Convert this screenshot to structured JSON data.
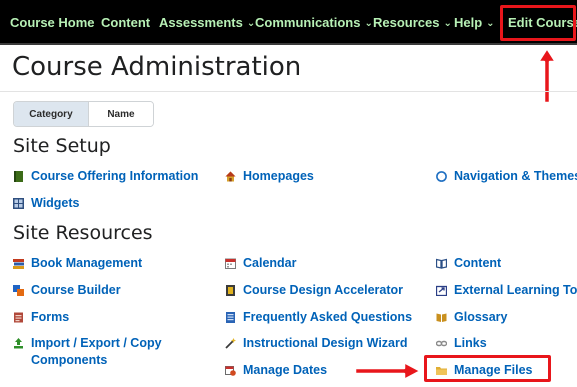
{
  "navbar": {
    "items": [
      {
        "label": "Course Home",
        "dropdown": false
      },
      {
        "label": "Content",
        "dropdown": false
      },
      {
        "label": "Assessments",
        "dropdown": true
      },
      {
        "label": "Communications",
        "dropdown": true
      },
      {
        "label": "Resources",
        "dropdown": true
      },
      {
        "label": "Help",
        "dropdown": true
      },
      {
        "label": "Edit Course",
        "dropdown": false
      }
    ],
    "chevron": "⌄"
  },
  "page": {
    "title": "Course Administration"
  },
  "view_toggle": {
    "category_label": "Category",
    "name_label": "Name"
  },
  "site_setup": {
    "heading": "Site Setup",
    "links": [
      {
        "label": "Course Offering Information",
        "icon": "book-icon"
      },
      {
        "label": "Homepages",
        "icon": "home-icon"
      },
      {
        "label": "Navigation & Themes",
        "icon": "compass-icon"
      },
      {
        "label": "Widgets",
        "icon": "widgets-icon"
      }
    ]
  },
  "site_resources": {
    "heading": "Site Resources",
    "links": [
      {
        "label": "Book Management",
        "icon": "books-icon"
      },
      {
        "label": "Calendar",
        "icon": "calendar-icon"
      },
      {
        "label": "Content",
        "icon": "open-book-icon"
      },
      {
        "label": "Course Builder",
        "icon": "builder-icon"
      },
      {
        "label": "Course Design Accelerator",
        "icon": "accelerator-icon"
      },
      {
        "label": "External Learning Tools",
        "icon": "external-tool-icon"
      },
      {
        "label": "Forms",
        "icon": "forms-icon"
      },
      {
        "label": "Frequently Asked Questions",
        "icon": "faq-icon"
      },
      {
        "label": "Glossary",
        "icon": "glossary-icon"
      },
      {
        "label": "Import / Export / Copy Components",
        "icon": "import-export-icon"
      },
      {
        "label": "Instructional Design Wizard",
        "icon": "wizard-icon"
      },
      {
        "label": "Links",
        "icon": "links-icon"
      },
      {
        "label": "Manage Dates",
        "icon": "manage-dates-icon"
      },
      {
        "label": "Manage Files",
        "icon": "folder-icon"
      }
    ]
  },
  "colors": {
    "nav_background": "#000000",
    "nav_text": "#b7f0b5",
    "link": "#0062b8",
    "highlight": "#e8161b"
  }
}
